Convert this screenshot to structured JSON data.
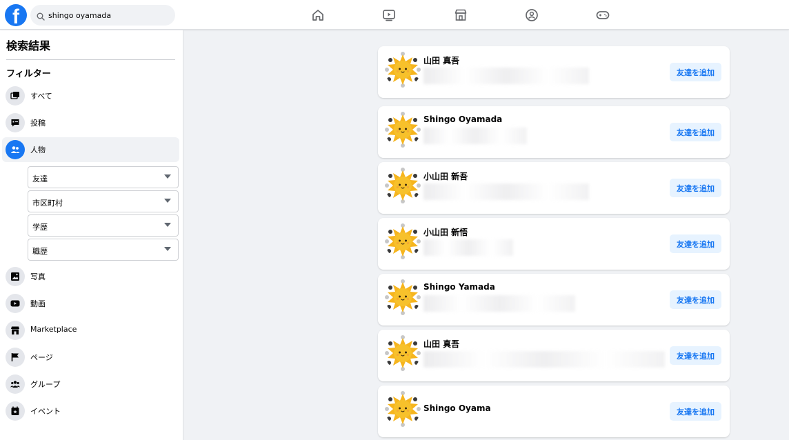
{
  "header": {
    "logo_letter": "f",
    "search_value": "shingo oyamada",
    "nav_icons": [
      "home-icon",
      "watch-icon",
      "marketplace-icon",
      "groups-icon",
      "gaming-icon"
    ]
  },
  "sidebar": {
    "title": "検索結果",
    "filter_heading": "フィルター",
    "items_top": [
      {
        "label": "すべて",
        "icon": "all-results-icon"
      },
      {
        "label": "投稿",
        "icon": "posts-icon"
      },
      {
        "label": "人物",
        "icon": "people-icon",
        "active": true
      }
    ],
    "people_filters": [
      {
        "label": "友達"
      },
      {
        "label": "市区町村"
      },
      {
        "label": "学歴"
      },
      {
        "label": "職歴"
      }
    ],
    "items_bottom": [
      {
        "label": "写真",
        "icon": "photos-icon"
      },
      {
        "label": "動画",
        "icon": "video-icon"
      },
      {
        "label": "Marketplace",
        "icon": "marketplace-icon"
      },
      {
        "label": "ページ",
        "icon": "flag-icon"
      },
      {
        "label": "グループ",
        "icon": "groups-icon"
      },
      {
        "label": "イベント",
        "icon": "calendar-icon"
      }
    ]
  },
  "results": [
    {
      "name": "山田 真吾",
      "button": "友達を追加"
    },
    {
      "name": "Shingo Oyamada",
      "button": "友達を追加"
    },
    {
      "name": "小山田 新吾",
      "button": "友達を追加"
    },
    {
      "name": "小山田 新悟",
      "button": "友達を追加"
    },
    {
      "name": "Shingo Yamada",
      "button": "友達を追加"
    },
    {
      "name": "山田 真吾",
      "button": "友達を追加"
    },
    {
      "name": "Shingo Oyama",
      "button": "友達を追加"
    }
  ],
  "colors": {
    "brand": "#1877f2",
    "background": "#f0f2f5",
    "button_bg": "#e7f3ff",
    "avatar_sun": "#f7c12b"
  }
}
